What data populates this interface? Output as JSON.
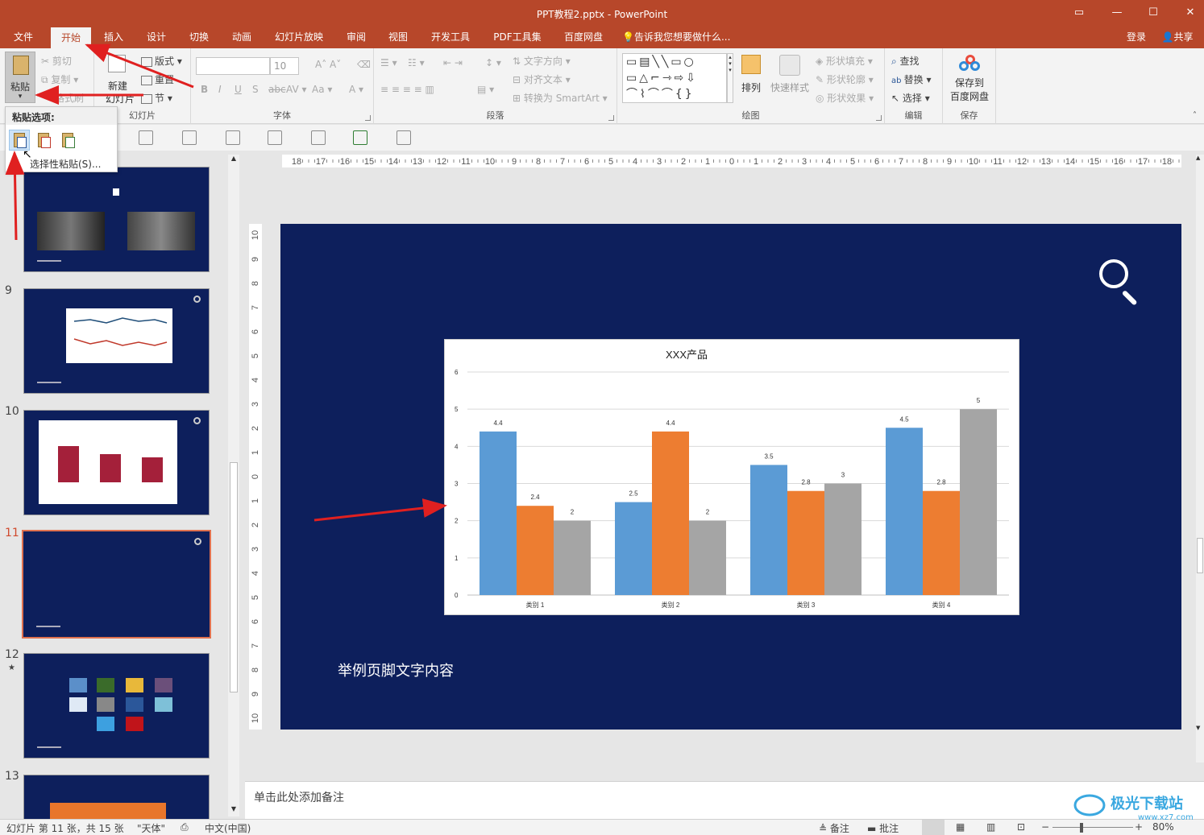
{
  "window": {
    "title": "PPT教程2.pptx - PowerPoint"
  },
  "tabs": [
    "文件",
    "开始",
    "插入",
    "设计",
    "切换",
    "动画",
    "幻灯片放映",
    "审阅",
    "视图",
    "开发工具",
    "PDF工具集",
    "百度网盘"
  ],
  "tell_me": "告诉我您想要做什么...",
  "account": {
    "login": "登录",
    "share": "共享"
  },
  "ribbon": {
    "clipboard": {
      "paste": "粘贴",
      "cut": "剪切",
      "copy": "复制",
      "format_painter": "格式刷"
    },
    "slides": {
      "new_slide_1": "新建",
      "new_slide_2": "幻灯片",
      "layout": "版式",
      "reset": "重置",
      "section": "节",
      "label": "幻灯片"
    },
    "font": {
      "size": "10",
      "label": "字体"
    },
    "paragraph": {
      "text_direction": "文字方向",
      "align_text": "对齐文本",
      "smartart": "转换为 SmartArt",
      "label": "段落"
    },
    "drawing": {
      "arrange": "排列",
      "quick_styles": "快速样式",
      "shape_fill": "形状填充",
      "shape_outline": "形状轮廓",
      "shape_effects": "形状效果",
      "label": "绘图"
    },
    "editing": {
      "find": "查找",
      "replace": "替换",
      "select": "选择",
      "label": "编辑"
    },
    "save": {
      "save_to_1": "保存到",
      "save_to_2": "百度网盘",
      "label": "保存"
    }
  },
  "paste_menu": {
    "header": "粘贴选项:",
    "special": "选择性粘贴(S)..."
  },
  "thumbnails": [
    {
      "num": "",
      "kind": "photos"
    },
    {
      "num": "9",
      "kind": "line"
    },
    {
      "num": "10",
      "kind": "bar"
    },
    {
      "num": "11",
      "kind": "blank",
      "selected": true
    },
    {
      "num": "12",
      "kind": "icons",
      "star": "★"
    },
    {
      "num": "13",
      "kind": "table"
    }
  ],
  "slide": {
    "footer_text": "举例页脚文字内容"
  },
  "chart_data": {
    "type": "bar",
    "title": "XXX产品",
    "categories": [
      "类别 1",
      "类别 2",
      "类别 3",
      "类别 4"
    ],
    "series": [
      {
        "values": [
          4.4,
          2.5,
          3.5,
          4.5
        ],
        "color": "#5b9bd5"
      },
      {
        "values": [
          2.4,
          4.4,
          2.8,
          2.8
        ],
        "color": "#ed7d31"
      },
      {
        "values": [
          2,
          2,
          3,
          5
        ],
        "color": "#a5a5a5"
      }
    ],
    "ylim": [
      0,
      6
    ],
    "yticks": [
      0,
      1,
      2,
      3,
      4,
      5,
      6
    ],
    "grid": true
  },
  "notes": {
    "placeholder": "单击此处添加备注"
  },
  "status": {
    "slide_info": "幻灯片 第 11 张，共 15 张",
    "theme": "\"天体\"",
    "language": "中文(中国)",
    "notes_btn": "备注",
    "comments_btn": "批注",
    "zoom": "80%"
  },
  "watermark": {
    "text": "极光下载站",
    "url": "www.xz7.com"
  },
  "colors": {
    "brand": "#b7472a",
    "slide_bg": "#0d1f5c",
    "annotation": "#e02020"
  }
}
